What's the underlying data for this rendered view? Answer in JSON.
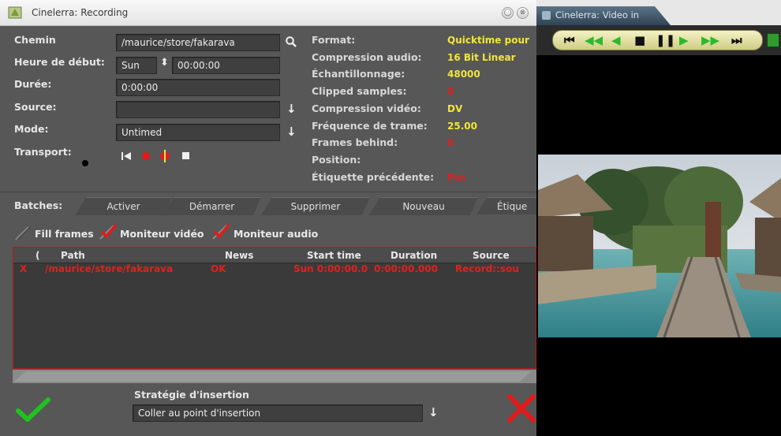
{
  "recording": {
    "title": "Cinelerra: Recording",
    "title_buttons": [
      "◯",
      "⊗"
    ],
    "labels": {
      "path": "Chemin",
      "start_time": "Heure de début:",
      "duration": "Durée:",
      "source": "Source:",
      "mode": "Mode:",
      "transport": "Transport:"
    },
    "fields": {
      "path": "/maurice/store/fakarava",
      "start_day": "Sun",
      "start_time": "00:00:00",
      "duration": "0:00:00",
      "source": "",
      "mode": "Untimed"
    },
    "info": [
      {
        "label": "Format:",
        "value": "Quicktime pour",
        "style": "yellow"
      },
      {
        "label": "Compression audio:",
        "value": "16 Bit Linear",
        "style": "yellow"
      },
      {
        "label": "Échantillonnage:",
        "value": "48000",
        "style": "yellow"
      },
      {
        "label": "Clipped samples:",
        "value": "0",
        "style": "red"
      },
      {
        "label": "Compression vidéo:",
        "value": "DV",
        "style": "yellow"
      },
      {
        "label": "Fréquence de trame:",
        "value": "25.00",
        "style": "yellow"
      },
      {
        "label": "Frames behind:",
        "value": "0",
        "style": "red"
      },
      {
        "label": "Position:",
        "value": "",
        "style": "yellow"
      },
      {
        "label": "Étiquette précédente:",
        "value": "Pas",
        "style": "red"
      }
    ],
    "batches": {
      "label": "Batches:",
      "tabs": [
        "Activer",
        "Démarrer",
        "Supprimer",
        "Nouveau",
        "Étique"
      ]
    },
    "checks": {
      "fill_frames": "Fill frames",
      "video_monitor": "Moniteur vidéo",
      "audio_monitor": "Moniteur audio"
    },
    "list": {
      "columns": [
        "(",
        "Path",
        "News",
        "Start time",
        "Duration",
        "Source"
      ],
      "rows": [
        {
          "mark": "X",
          "path": "/maurice/store/fakarava",
          "news": "OK",
          "start": "Sun 0:00:00.0",
          "duration": "0:00:00.000",
          "source": "Record::sou"
        }
      ]
    },
    "insertion": {
      "label": "Stratégie d'insertion",
      "value": "Coller au point d'insertion"
    },
    "colors": {
      "accent_yellow": "#f2e53a",
      "accent_red": "#e02020",
      "ok_green": "#1fc21f"
    }
  },
  "video": {
    "title": "Cinelerra: Video in"
  }
}
